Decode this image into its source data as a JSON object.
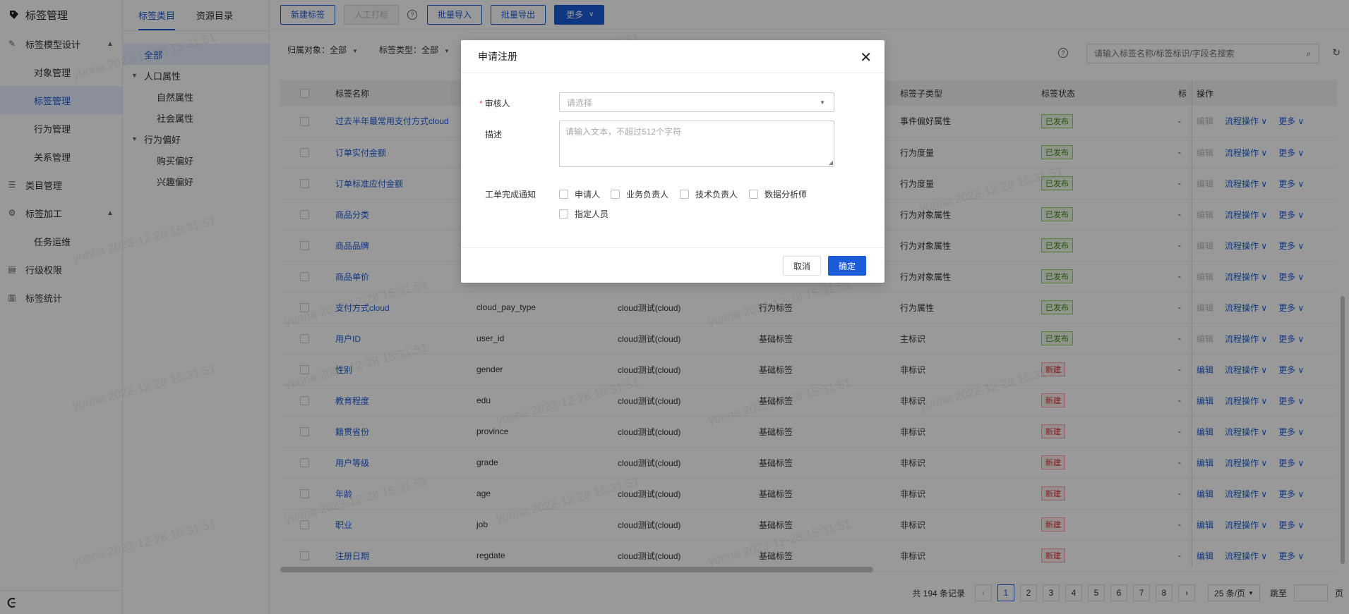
{
  "app": {
    "title": "标签管理"
  },
  "sidebar": {
    "groups": [
      {
        "label": "标签模型设计",
        "children": [
          "对象管理",
          "标签管理",
          "行为管理",
          "关系管理"
        ]
      },
      {
        "label": "类目管理"
      },
      {
        "label": "标签加工",
        "children": [
          "任务运维"
        ]
      },
      {
        "label": "行级权限"
      },
      {
        "label": "标签统计"
      }
    ]
  },
  "tree": {
    "tabs": [
      "标签类目",
      "资源目录"
    ],
    "nodes": [
      "全部",
      "人口属性",
      "自然属性",
      "社会属性",
      "行为偏好",
      "购买偏好",
      "兴趣偏好"
    ]
  },
  "toolbar": {
    "new": "新建标签",
    "manual": "人工打标",
    "import": "批量导入",
    "export": "批量导出",
    "more": "更多"
  },
  "filters": {
    "owner": "归属对象：全部",
    "type": "标签类型：全部"
  },
  "search": {
    "placeholder": "请输入标签名称/标签标识/字段名搜索"
  },
  "table": {
    "headers": [
      "标签名称",
      "标签子类型",
      "标签状态",
      "标",
      "操作"
    ],
    "rows": [
      {
        "name": "过去半年最常用支付方式cloud",
        "id": "",
        "src": "",
        "type": "",
        "sub": "事件偏好属性",
        "status": "已发布",
        "extra": "-"
      },
      {
        "name": "订单实付金额",
        "id": "",
        "src": "",
        "type": "",
        "sub": "行为度量",
        "status": "已发布",
        "extra": "-"
      },
      {
        "name": "订单标准应付金额",
        "id": "",
        "src": "",
        "type": "",
        "sub": "行为度量",
        "status": "已发布",
        "extra": "-"
      },
      {
        "name": "商品分类",
        "id": "",
        "src": "",
        "type": "",
        "sub": "行为对象属性",
        "status": "已发布",
        "extra": "-"
      },
      {
        "name": "商品品牌",
        "id": "",
        "src": "",
        "type": "",
        "sub": "行为对象属性",
        "status": "已发布",
        "extra": "-"
      },
      {
        "name": "商品单价",
        "id": "",
        "src": "",
        "type": "",
        "sub": "行为对象属性",
        "status": "已发布",
        "extra": "-"
      },
      {
        "name": "支付方式cloud",
        "id": "cloud_pay_type",
        "src": "cloud测试(cloud)",
        "type": "行为标签",
        "sub": "行为属性",
        "status": "已发布",
        "extra": "-"
      },
      {
        "name": "用户ID",
        "id": "user_id",
        "src": "cloud测试(cloud)",
        "type": "基础标签",
        "sub": "主标识",
        "status": "已发布",
        "extra": "-"
      },
      {
        "name": "性别",
        "id": "gender",
        "src": "cloud测试(cloud)",
        "type": "基础标签",
        "sub": "非标识",
        "status": "新建",
        "extra": "-"
      },
      {
        "name": "教育程度",
        "id": "edu",
        "src": "cloud测试(cloud)",
        "type": "基础标签",
        "sub": "非标识",
        "status": "新建",
        "extra": "-"
      },
      {
        "name": "籍贯省份",
        "id": "province",
        "src": "cloud测试(cloud)",
        "type": "基础标签",
        "sub": "非标识",
        "status": "新建",
        "extra": "-"
      },
      {
        "name": "用户等级",
        "id": "grade",
        "src": "cloud测试(cloud)",
        "type": "基础标签",
        "sub": "非标识",
        "status": "新建",
        "extra": "-"
      },
      {
        "name": "年龄",
        "id": "age",
        "src": "cloud测试(cloud)",
        "type": "基础标签",
        "sub": "非标识",
        "status": "新建",
        "extra": "-"
      },
      {
        "name": "职业",
        "id": "job",
        "src": "cloud测试(cloud)",
        "type": "基础标签",
        "sub": "非标识",
        "status": "新建",
        "extra": "-"
      },
      {
        "name": "注册日期",
        "id": "regdate",
        "src": "cloud测试(cloud)",
        "type": "基础标签",
        "sub": "非标识",
        "status": "新建",
        "extra": "-"
      }
    ],
    "ops": {
      "edit": "编辑",
      "flow": "流程操作",
      "more": "更多"
    }
  },
  "pager": {
    "total": "共 194 条记录",
    "pages": [
      "1",
      "2",
      "3",
      "4",
      "5",
      "6",
      "7",
      "8"
    ],
    "current": 1,
    "size": "25 条/页",
    "jump": "跳至",
    "page_unit": "页"
  },
  "watermark": "yunna 2023-12-28 15:31:51",
  "modal": {
    "title": "申请注册",
    "reviewer_label": "审核人",
    "reviewer_placeholder": "请选择",
    "desc_label": "描述",
    "desc_placeholder": "请输入文本，不超过512个字符",
    "notify_label": "工单完成通知",
    "notify_options": [
      "申请人",
      "业务负责人",
      "技术负责人",
      "数据分析师",
      "指定人员"
    ],
    "cancel": "取消",
    "ok": "确定"
  },
  "colors": {
    "accent": "#1c5cd8",
    "published": "#3a8a16",
    "new": "#d82c2c"
  }
}
